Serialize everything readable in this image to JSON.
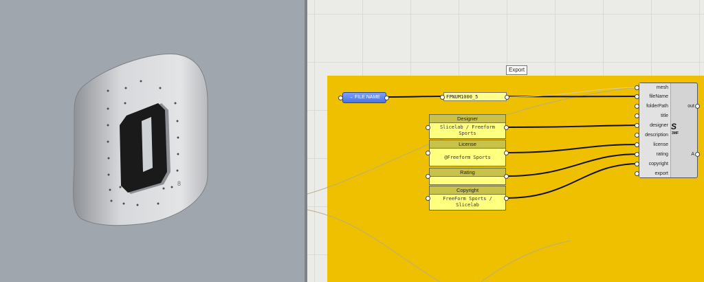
{
  "group": {
    "label": "Export"
  },
  "components": {
    "filename_param": "→ FILE NAME",
    "filename_value": "FPNUM1000_5",
    "panels": [
      {
        "id": "designer",
        "header": "Designer",
        "lines": [
          "Slicelab / Freeform",
          "Sports"
        ]
      },
      {
        "id": "license",
        "header": "License",
        "lines": [
          "@Freeform Sports"
        ]
      },
      {
        "id": "rating",
        "header": "Rating",
        "lines": [
          ""
        ]
      },
      {
        "id": "copyright",
        "header": "Copyright",
        "lines": [
          "FreeForm Sports /",
          "Slicelab"
        ]
      }
    ]
  },
  "exporter": {
    "inputs": [
      "mesh",
      "fileName",
      "folderPath",
      "title",
      "designer",
      "description",
      "license",
      "rating",
      "copyright",
      "export"
    ],
    "outputs": [
      "out",
      "A"
    ],
    "logo_text": "S",
    "logo_sub": "3MF"
  },
  "viewport": {
    "model_digit": "0",
    "colors": {
      "background": "#a0a6ad",
      "shield": "#d8dadd",
      "digit": "#1a1a1a"
    }
  },
  "colors": {
    "group": "#efc000",
    "panel": "#ffff80",
    "param_blue": "#4b72e0"
  }
}
